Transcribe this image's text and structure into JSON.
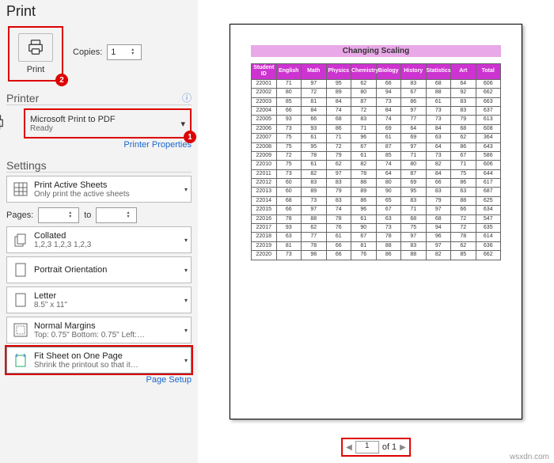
{
  "title": "Print",
  "print_button": "Print",
  "copies": {
    "label": "Copies:",
    "value": "1"
  },
  "badges": {
    "printer": "1",
    "print": "2"
  },
  "printer": {
    "heading": "Printer",
    "name": "Microsoft Print to PDF",
    "status": "Ready",
    "properties": "Printer Properties"
  },
  "settings": {
    "heading": "Settings",
    "active_sheets": {
      "main": "Print Active Sheets",
      "sub": "Only print the active sheets"
    },
    "pages": {
      "label": "Pages:",
      "to": "to"
    },
    "collated": {
      "main": "Collated",
      "sub": "1,2,3    1,2,3    1,2,3"
    },
    "orientation": {
      "main": "Portrait Orientation"
    },
    "paper": {
      "main": "Letter",
      "sub": "8.5\" x 11\""
    },
    "margins": {
      "main": "Normal Margins",
      "sub": "Top: 0.75\" Bottom: 0.75\" Left:…"
    },
    "scaling": {
      "main": "Fit Sheet on One Page",
      "sub": "Shrink the printout so that it…"
    },
    "page_setup": "Page Setup"
  },
  "nav": {
    "page": "1",
    "of": "of 1"
  },
  "watermark": "wsxdn.com",
  "chart_data": {
    "type": "table",
    "title": "Changing Scaling",
    "columns": [
      "Student ID",
      "English",
      "Math",
      "Physics",
      "Chemistry",
      "Biology",
      "History",
      "Statistics",
      "Art",
      "Total"
    ],
    "rows": [
      [
        "22001",
        "71",
        "97",
        "95",
        "62",
        "66",
        "83",
        "68",
        "64",
        "606"
      ],
      [
        "22002",
        "80",
        "72",
        "89",
        "80",
        "94",
        "67",
        "88",
        "92",
        "662"
      ],
      [
        "22003",
        "85",
        "81",
        "84",
        "87",
        "73",
        "86",
        "61",
        "83",
        "663"
      ],
      [
        "22004",
        "66",
        "84",
        "74",
        "72",
        "84",
        "97",
        "73",
        "83",
        "637"
      ],
      [
        "22005",
        "93",
        "66",
        "68",
        "83",
        "74",
        "77",
        "73",
        "79",
        "613"
      ],
      [
        "22006",
        "73",
        "93",
        "86",
        "71",
        "69",
        "64",
        "84",
        "68",
        "608"
      ],
      [
        "22007",
        "75",
        "61",
        "71",
        "96",
        "61",
        "69",
        "63",
        "62",
        "364"
      ],
      [
        "22008",
        "75",
        "95",
        "72",
        "67",
        "87",
        "97",
        "64",
        "86",
        "643"
      ],
      [
        "22009",
        "72",
        "78",
        "79",
        "61",
        "85",
        "71",
        "73",
        "67",
        "586"
      ],
      [
        "22010",
        "75",
        "61",
        "62",
        "82",
        "74",
        "80",
        "82",
        "71",
        "606"
      ],
      [
        "22011",
        "73",
        "82",
        "97",
        "78",
        "64",
        "87",
        "84",
        "75",
        "644"
      ],
      [
        "22012",
        "60",
        "83",
        "83",
        "88",
        "80",
        "69",
        "66",
        "86",
        "617"
      ],
      [
        "22013",
        "60",
        "89",
        "79",
        "89",
        "90",
        "95",
        "83",
        "63",
        "687"
      ],
      [
        "22014",
        "68",
        "73",
        "83",
        "86",
        "65",
        "83",
        "79",
        "88",
        "625"
      ],
      [
        "22015",
        "66",
        "97",
        "74",
        "96",
        "67",
        "71",
        "97",
        "66",
        "634"
      ],
      [
        "22016",
        "78",
        "88",
        "78",
        "61",
        "63",
        "68",
        "68",
        "72",
        "547"
      ],
      [
        "22017",
        "93",
        "62",
        "76",
        "90",
        "73",
        "75",
        "94",
        "72",
        "635"
      ],
      [
        "22018",
        "63",
        "77",
        "61",
        "67",
        "78",
        "97",
        "96",
        "78",
        "614"
      ],
      [
        "22019",
        "81",
        "78",
        "66",
        "81",
        "88",
        "83",
        "97",
        "62",
        "636"
      ],
      [
        "22020",
        "73",
        "98",
        "66",
        "76",
        "86",
        "88",
        "82",
        "85",
        "662"
      ]
    ]
  }
}
